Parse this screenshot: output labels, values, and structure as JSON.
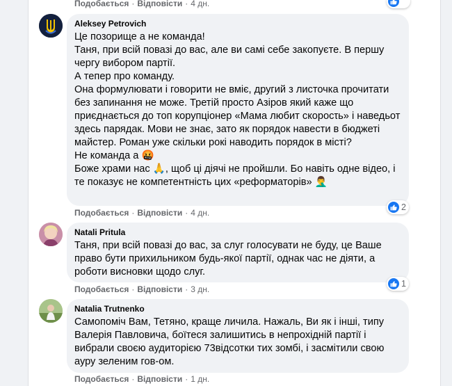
{
  "comments": [
    {
      "author": "Aleksey Petrovich",
      "text": "Це позорище а не команда!\nТаня, при всій повазі до вас, але ви самі себе закопуєте. В першу чергу вибором партії.\nА тепер про команду.\nОна формулювати і говорити не вміє, другий з листочка прочитати без запинання не може. Третій просто Азіров який каже що приєднається до топ корупціонер «Мама любит скоросτь» і наведьот здесь парядак. Мови не знає, зато як порядок навести в бюджеті майстер. Роман уже скільки рокі наводить порядок в місті?\nНе команда а 🤬\nБоже храми нас 🙏, щоб ці діячі не пройшли. Бо навіть одне відео, і те показує не компетентність цих «реформаторів» 🤦‍♂️",
      "like": "Подобається",
      "reply": "Відповісти",
      "time": "4 дн.",
      "reactions": "2"
    },
    {
      "author": "Natali Pritula",
      "text": "Таня, при всій повазі до вас, за слуг голосувати не буду, це Ваше право бути прихильником будь-якої партії, однак час не діяти, а роботи висновки щодо слуг.",
      "like": "Подобається",
      "reply": "Відповісти",
      "time": "3 дн.",
      "reactions": "1"
    },
    {
      "author": "Natalia Trutnenko",
      "text": "Самопоміч Вам, Тетяно, краще личила. Нажаль, Ви як і інші, типу Валерія Павловича, боїтеся залишитись в непрохідній партії і вибрали своєю аудиторією 73відсотки тих зомбі, і засмітили свою ауру зеленим гов-ом.",
      "like": "Подобається",
      "reply": "Відповісти",
      "time": "1 дн."
    }
  ],
  "top_actions": {
    "like": "Подобається",
    "reply": "Відповісти",
    "time": "4 дн."
  },
  "icons": {
    "like": "like-icon",
    "avatar_1": "trident-emblem-avatar",
    "avatar_2": "woman-photo-avatar",
    "avatar_3": "outdoor-photo-avatar"
  },
  "colors": {
    "page_bg": "#f0f2f5",
    "bubble_bg": "#f0f2f5",
    "meta": "#65676b",
    "like_blue": "#1877f2"
  }
}
